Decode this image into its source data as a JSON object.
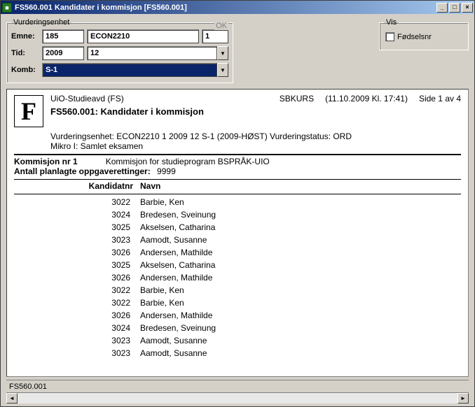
{
  "window": {
    "title": "FS560.001 Kandidater i kommisjon [FS560.001]"
  },
  "form": {
    "legend": "Vurderingsenhet",
    "ok": "OK",
    "emne_label": "Emne:",
    "emne_code": "185",
    "emne_subject": "ECON2210",
    "emne_seq": "1",
    "tid_label": "Tid:",
    "tid_year": "2009",
    "tid_month": "12",
    "komb_label": "Komb:",
    "komb_value": "S-1"
  },
  "vis": {
    "legend": "Vis",
    "fodselsnr_label": "Fødselsnr"
  },
  "report": {
    "org": "UiO-Studieavd (FS)",
    "user": "SBKURS",
    "timestamp": "(11.10.2009 Kl. 17:41)",
    "page": "Side 1 av 4",
    "title": "FS560.001: Kandidater i kommisjon",
    "unitline": "Vurderingsenhet: ECON2210 1 2009 12 S-1 (2009-HØST) Vurderingstatus: ORD",
    "subline": "Mikro I: Samlet eksamen",
    "kommisjon_label": "Kommisjon nr 1",
    "kommisjon_text": "Kommisjon for studieprogram BSPRÅK-UIO",
    "antall_label": "Antall planlagte oppgaverettinger:",
    "antall_value": "9999",
    "col_kandidatnr": "Kandidatnr",
    "col_navn": "Navn",
    "rows": [
      {
        "nr": "3022",
        "navn": "Barbie, Ken"
      },
      {
        "nr": "3024",
        "navn": "Bredesen, Sveinung"
      },
      {
        "nr": "3025",
        "navn": "Akselsen, Catharina"
      },
      {
        "nr": "3023",
        "navn": "Aamodt, Susanne"
      },
      {
        "nr": "3026",
        "navn": "Andersen, Mathilde"
      },
      {
        "nr": "3025",
        "navn": "Akselsen, Catharina"
      },
      {
        "nr": "3026",
        "navn": "Andersen, Mathilde"
      },
      {
        "nr": "3022",
        "navn": "Barbie, Ken"
      },
      {
        "nr": "3022",
        "navn": "Barbie, Ken"
      },
      {
        "nr": "3026",
        "navn": "Andersen, Mathilde"
      },
      {
        "nr": "3024",
        "navn": "Bredesen, Sveinung"
      },
      {
        "nr": "3023",
        "navn": "Aamodt, Susanne"
      },
      {
        "nr": "3023",
        "navn": "Aamodt, Susanne"
      }
    ]
  },
  "status": "FS560.001"
}
